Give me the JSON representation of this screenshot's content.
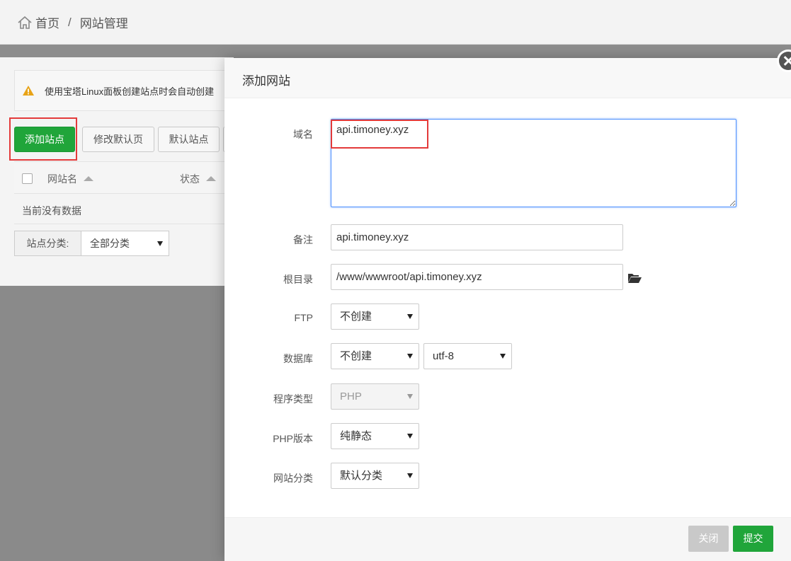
{
  "breadcrumb": {
    "home": "首页",
    "separator": "/",
    "current": "网站管理"
  },
  "notice": {
    "text": "使用宝塔Linux面板创建站点时会自动创建"
  },
  "toolbar": {
    "add_site": "添加站点",
    "edit_default_page": "修改默认页",
    "default_site": "默认站点"
  },
  "table": {
    "columns": [
      "网站名",
      "状态"
    ],
    "empty_text": "当前没有数据"
  },
  "category_filter": {
    "label": "站点分类:",
    "selected": "全部分类"
  },
  "modal": {
    "title": "添加网站",
    "fields": {
      "domain_label": "域名",
      "domain_value": "api.timoney.xyz",
      "remark_label": "备注",
      "remark_value": "api.timoney.xyz",
      "root_label": "根目录",
      "root_value": "/www/wwwroot/api.timoney.xyz",
      "ftp_label": "FTP",
      "ftp_value": "不创建",
      "db_label": "数据库",
      "db_value": "不创建",
      "db_charset": "utf-8",
      "program_type_label": "程序类型",
      "program_type_value": "PHP",
      "php_version_label": "PHP版本",
      "php_version_value": "纯静态",
      "site_category_label": "网站分类",
      "site_category_value": "默认分类"
    },
    "buttons": {
      "close": "关闭",
      "submit": "提交"
    }
  },
  "colors": {
    "accent_green": "#20a53a",
    "highlight_red": "#e33a3a",
    "focus_blue": "#4d90fe"
  }
}
